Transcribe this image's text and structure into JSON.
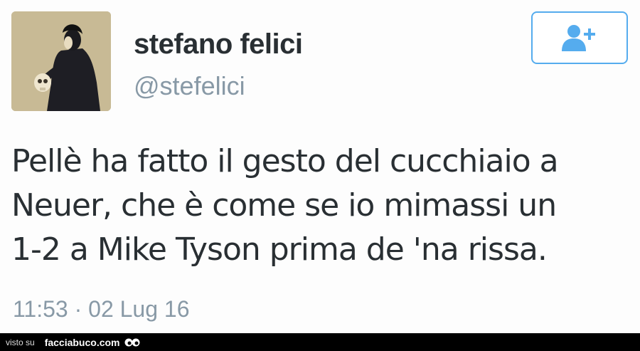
{
  "tweet": {
    "display_name": "stefano felici",
    "handle": "@stefelici",
    "text_lines": [
      "Pellè ha fatto il gesto del cucchiaio a",
      "Neuer, che è come se io mimassi un",
      "1-2 a Mike Tyson prima de 'na rissa."
    ],
    "timestamp": "11:53 · 02 Lug 16",
    "follow_icon": "add-user-icon",
    "accent_color": "#55acee"
  },
  "footer": {
    "visto_label": "visto su",
    "site_label": "facciabuco.com",
    "logo_icon": "eyes-icon"
  }
}
